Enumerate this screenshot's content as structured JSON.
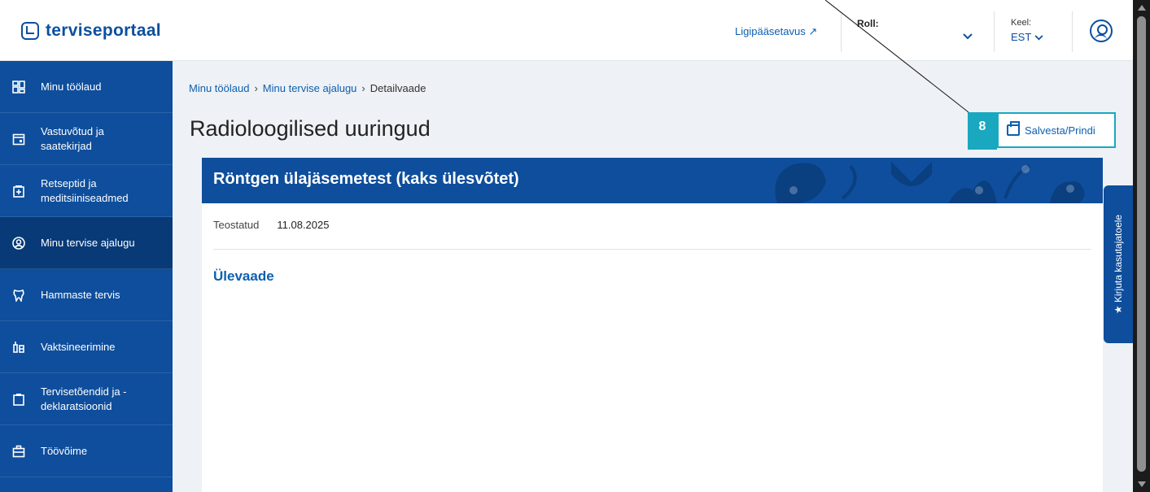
{
  "header": {
    "logo_text": "terviseportaal",
    "access_link": "Ligipääsetavus ↗",
    "role_label": "Roll:",
    "role_chevron": "⌄",
    "lang_label": "Keel:",
    "lang_value": "EST ⌄"
  },
  "sidebar": {
    "items": [
      {
        "label": "Minu töölaud",
        "icon": "dashboard-icon"
      },
      {
        "label": "Vastuvõtud ja\nsaatekirjad",
        "icon": "calendar-icon"
      },
      {
        "label": "Retseptid ja\nmeditsiiniseadmed",
        "icon": "prescription-icon"
      },
      {
        "label": "Minu tervise ajalugu",
        "icon": "person-icon"
      },
      {
        "label": "Hammaste tervis",
        "icon": "tooth-icon"
      },
      {
        "label": "Vaktsineerimine",
        "icon": "syringe-icon"
      },
      {
        "label": "Tervisetõendid ja -\ndeklaratsioonid",
        "icon": "clipboard-icon"
      },
      {
        "label": "Töövõime",
        "icon": "briefcase-icon"
      }
    ]
  },
  "breadcrumb": {
    "items": [
      "Minu töölaud",
      "Minu tervise ajalugu",
      "Detailvaade"
    ],
    "separator": "›"
  },
  "page": {
    "title": "Radioloogilised uuringud",
    "save_label": "Salvesta/Prindi",
    "badge": "8"
  },
  "card": {
    "title": "Röntgen ülajäsemetest (kaks ülesvõtet)",
    "meta_label": "Teostatud",
    "meta_value": "11.08.2025",
    "section_title": "Ülevaade"
  },
  "feedback": {
    "label": "★ Kirjuta kasutajatoele"
  },
  "colors": {
    "brand": "#0e4e9c",
    "accent": "#19a8c0",
    "link": "#0d5fb0"
  }
}
